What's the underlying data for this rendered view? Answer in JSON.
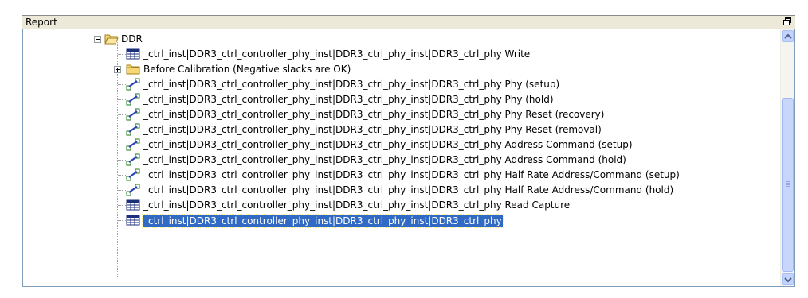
{
  "panel": {
    "title": "Report"
  },
  "tree": {
    "root": {
      "label": "DDR",
      "icon": "folder-open-icon"
    },
    "items": [
      {
        "label": "_ctrl_inst|DDR3_ctrl_controller_phy_inst|DDR3_ctrl_phy_inst|DDR3_ctrl_phy Write",
        "icon": "table-icon"
      },
      {
        "label": "Before Calibration (Negative slacks are OK)",
        "icon": "folder-icon"
      },
      {
        "label": "_ctrl_inst|DDR3_ctrl_controller_phy_inst|DDR3_ctrl_phy_inst|DDR3_ctrl_phy Phy (setup)",
        "icon": "chart-icon"
      },
      {
        "label": "_ctrl_inst|DDR3_ctrl_controller_phy_inst|DDR3_ctrl_phy_inst|DDR3_ctrl_phy Phy (hold)",
        "icon": "chart-icon"
      },
      {
        "label": "_ctrl_inst|DDR3_ctrl_controller_phy_inst|DDR3_ctrl_phy_inst|DDR3_ctrl_phy Phy Reset (recovery)",
        "icon": "chart-icon"
      },
      {
        "label": "_ctrl_inst|DDR3_ctrl_controller_phy_inst|DDR3_ctrl_phy_inst|DDR3_ctrl_phy Phy Reset (removal)",
        "icon": "chart-icon"
      },
      {
        "label": "_ctrl_inst|DDR3_ctrl_controller_phy_inst|DDR3_ctrl_phy_inst|DDR3_ctrl_phy Address Command (setup)",
        "icon": "chart-icon"
      },
      {
        "label": "_ctrl_inst|DDR3_ctrl_controller_phy_inst|DDR3_ctrl_phy_inst|DDR3_ctrl_phy Address Command (hold)",
        "icon": "chart-icon"
      },
      {
        "label": "_ctrl_inst|DDR3_ctrl_controller_phy_inst|DDR3_ctrl_phy_inst|DDR3_ctrl_phy Half Rate Address/Command (setup)",
        "icon": "chart-icon"
      },
      {
        "label": "_ctrl_inst|DDR3_ctrl_controller_phy_inst|DDR3_ctrl_phy_inst|DDR3_ctrl_phy Half Rate Address/Command (hold)",
        "icon": "chart-icon"
      },
      {
        "label": "_ctrl_inst|DDR3_ctrl_controller_phy_inst|DDR3_ctrl_phy_inst|DDR3_ctrl_phy Read Capture",
        "icon": "table-icon"
      },
      {
        "label": "_ctrl_inst|DDR3_ctrl_controller_phy_inst|DDR3_ctrl_phy_inst|DDR3_ctrl_phy",
        "icon": "table-icon",
        "selected": true
      }
    ]
  },
  "colors": {
    "selection": "#316ac5",
    "scrollbar": "#c8d6fb",
    "folder": "#f7d774"
  }
}
